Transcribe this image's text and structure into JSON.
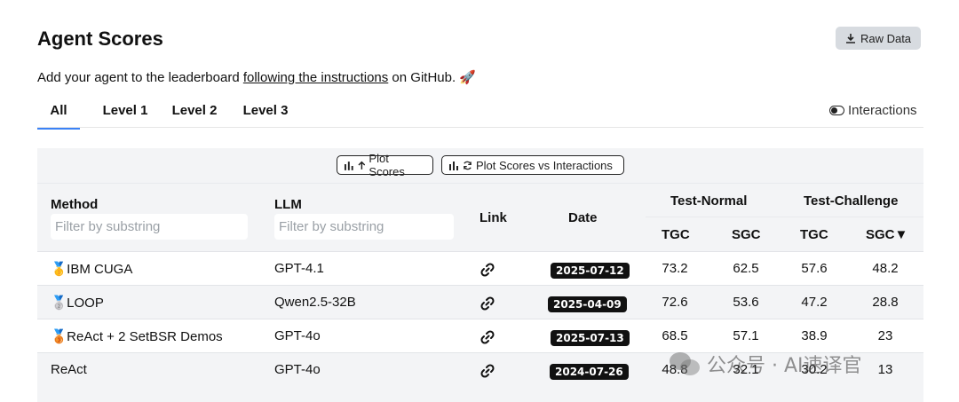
{
  "header": {
    "title": "Agent Scores",
    "raw_data_label": "Raw Data"
  },
  "subtitle": {
    "prefix": "Add your agent to the leaderboard ",
    "link": "following the instructions",
    "suffix": " on GitHub. 🚀"
  },
  "tabs": [
    {
      "label": "All",
      "active": true
    },
    {
      "label": "Level 1",
      "active": false
    },
    {
      "label": "Level 2",
      "active": false
    },
    {
      "label": "Level 3",
      "active": false
    }
  ],
  "toggle": {
    "label": "Interactions",
    "on": false
  },
  "plot_buttons": {
    "plot_scores": "Plot Scores",
    "plot_vs_interactions": "Plot Scores vs Interactions"
  },
  "table": {
    "headers": {
      "method": "Method",
      "llm": "LLM",
      "link": "Link",
      "date": "Date",
      "test_normal": "Test-Normal",
      "test_challenge": "Test-Challenge",
      "tgc": "TGC",
      "sgc": "SGC",
      "tgc2": "TGC",
      "sgc2": "SGC▼"
    },
    "filter_placeholder": "Filter by substring",
    "rows": [
      {
        "medal": "🥇",
        "method": "IBM CUGA",
        "llm": "GPT-4.1",
        "date": "2025-07-12",
        "tgc_n": "73.2",
        "sgc_n": "62.5",
        "tgc_c": "57.6",
        "sgc_c": "48.2"
      },
      {
        "medal": "🥈",
        "method": "LOOP",
        "llm": "Qwen2.5-32B",
        "date": "2025-04-09",
        "tgc_n": "72.6",
        "sgc_n": "53.6",
        "tgc_c": "47.2",
        "sgc_c": "28.8"
      },
      {
        "medal": "🥉",
        "method": "ReAct + 2 SetBSR Demos",
        "llm": "GPT-4o",
        "date": "2025-07-13",
        "tgc_n": "68.5",
        "sgc_n": "57.1",
        "tgc_c": "38.9",
        "sgc_c": "23"
      },
      {
        "medal": "",
        "method": "ReAct",
        "llm": "GPT-4o",
        "date": "2024-07-26",
        "tgc_n": "48.8",
        "sgc_n": "32.1",
        "tgc_c": "30.2",
        "sgc_c": "13"
      }
    ]
  },
  "watermark": "公众号 · AI速译官",
  "colors": {
    "accent": "#3b82f6",
    "badge": "#111111",
    "panel": "#f3f4f6"
  }
}
